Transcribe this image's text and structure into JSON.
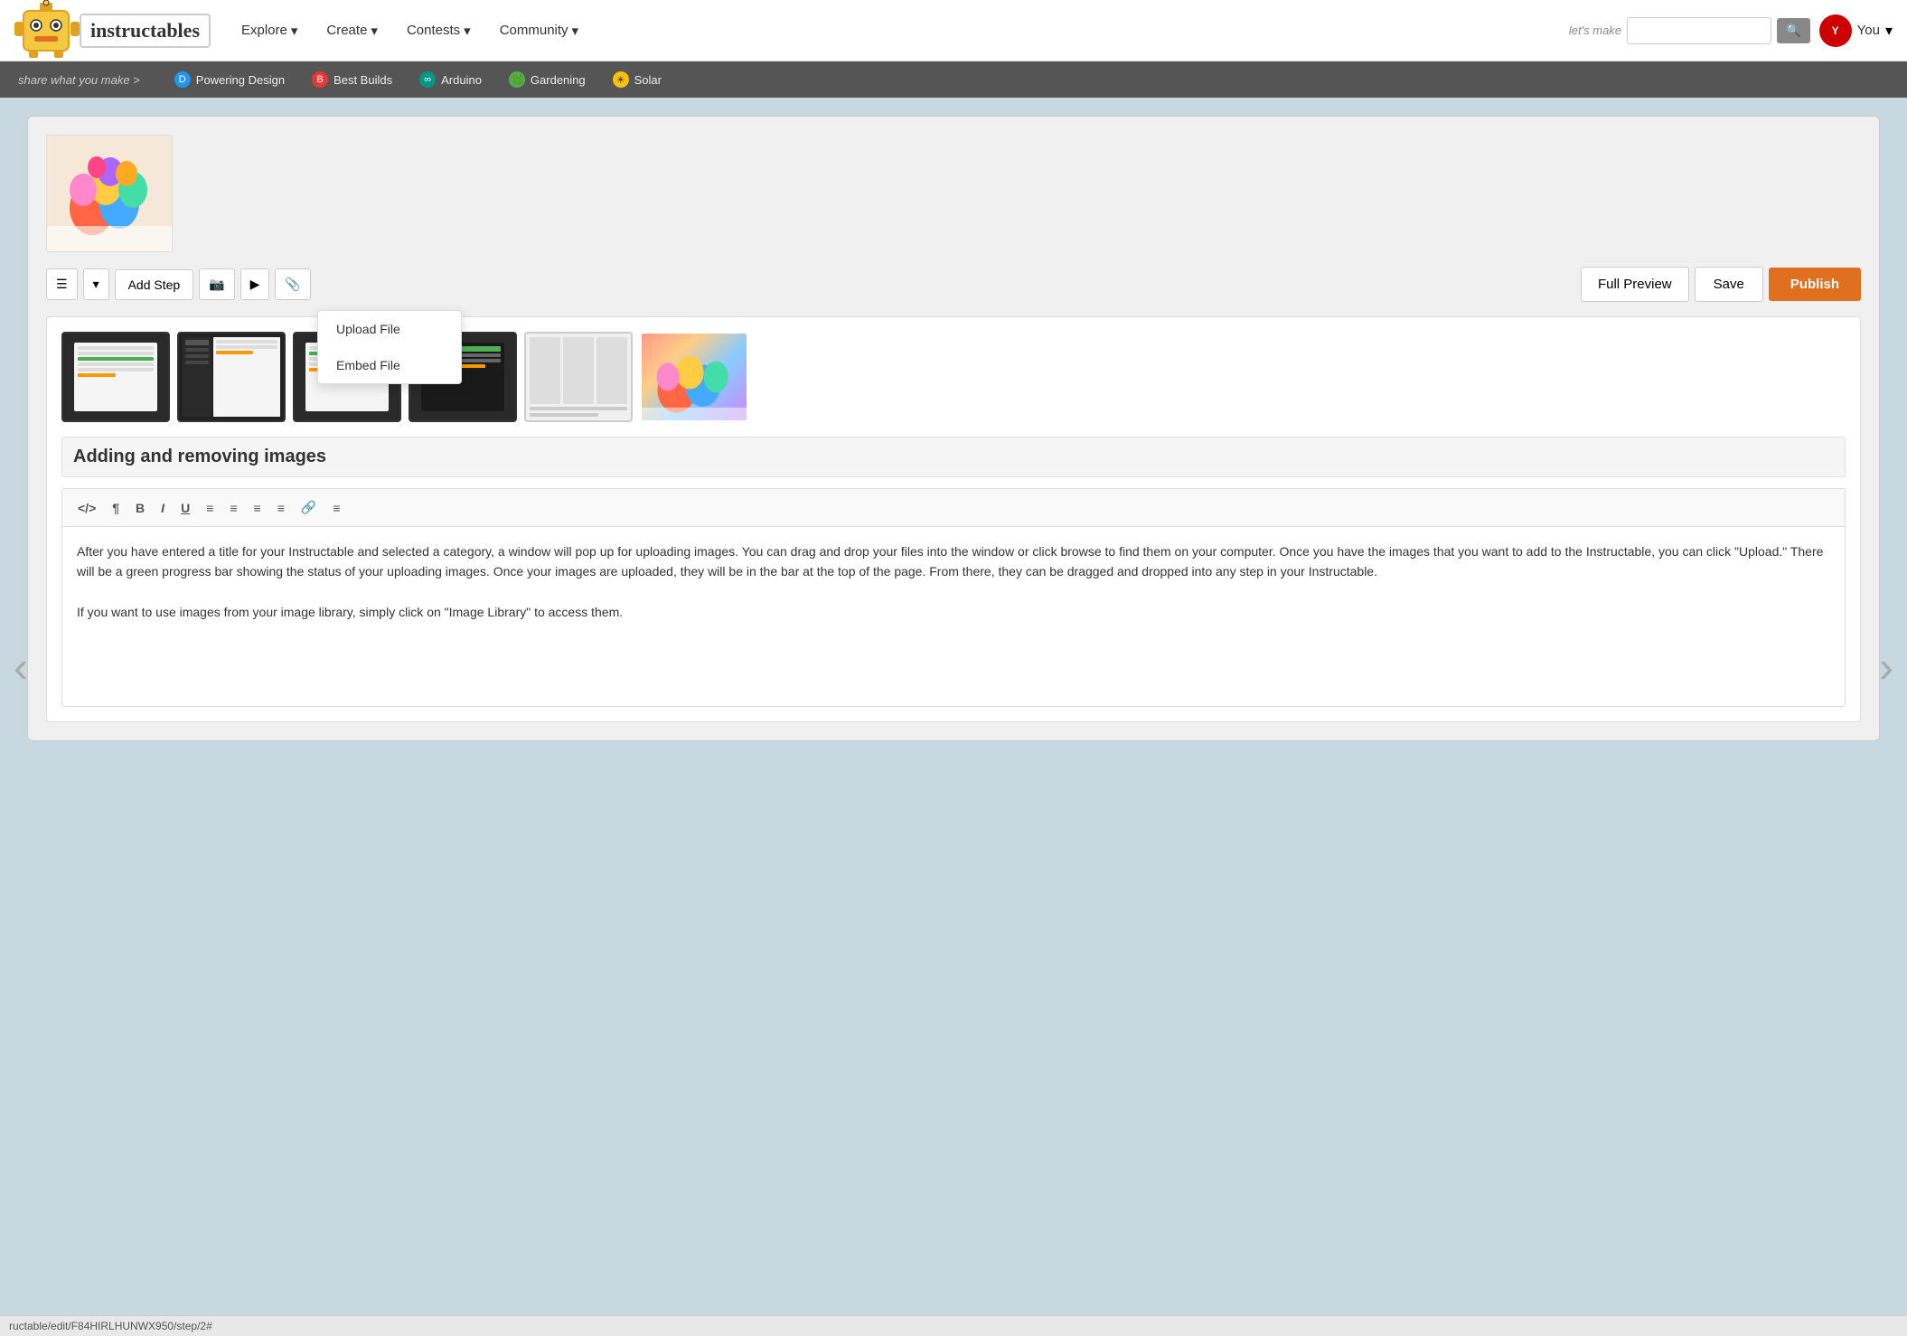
{
  "site": {
    "name": "instructables",
    "tagline": "share what you make >"
  },
  "nav": {
    "links": [
      {
        "label": "Explore",
        "has_dropdown": true
      },
      {
        "label": "Create",
        "has_dropdown": true
      },
      {
        "label": "Contests",
        "has_dropdown": true
      },
      {
        "label": "Community",
        "has_dropdown": true
      }
    ],
    "search_placeholder": "",
    "lets_make": "let's make",
    "user_label": "You",
    "user_initials": "Y"
  },
  "sub_nav": {
    "share_text": "share what you make >",
    "links": [
      {
        "label": "Powering Design",
        "icon_type": "blue",
        "icon_text": "D"
      },
      {
        "label": "Best Builds",
        "icon_type": "red",
        "icon_text": "B"
      },
      {
        "label": "Arduino",
        "icon_type": "teal",
        "icon_text": "∞"
      },
      {
        "label": "Gardening",
        "icon_type": "green",
        "icon_text": "🌿"
      },
      {
        "label": "Solar",
        "icon_type": "yellow",
        "icon_text": "☀"
      }
    ]
  },
  "toolbar": {
    "add_step_label": "Add Step",
    "full_preview_label": "Full Preview",
    "save_label": "Save",
    "publish_label": "Publish"
  },
  "dropdown": {
    "items": [
      {
        "label": "Upload File"
      },
      {
        "label": "Embed File"
      }
    ]
  },
  "step": {
    "title": "Adding and removing images",
    "body_paragraphs": [
      "After you have entered a title for your Instructable and selected a category, a window will pop up for uploading images. You can drag and drop your files into the window or click browse to find them on your computer. Once you have the images that you want to add to the Instructable, you can click \"Upload.\" There will be a green progress bar showing the status of your uploading images. Once your images are uploaded, they will be in the bar at the top of the page. From there, they can be dragged and dropped into any step in your Instructable.",
      "If you want to use images from your image library, simply click on \"Image Library\" to access them."
    ]
  },
  "editor_toolbar": {
    "buttons": [
      "</>",
      "¶",
      "B",
      "I",
      "U",
      "≡",
      "≡",
      "≡",
      "≡",
      "🔗",
      "≡"
    ]
  },
  "status_bar": {
    "url": "ructable/edit/F84HIRLHUNWX950/step/2#"
  }
}
